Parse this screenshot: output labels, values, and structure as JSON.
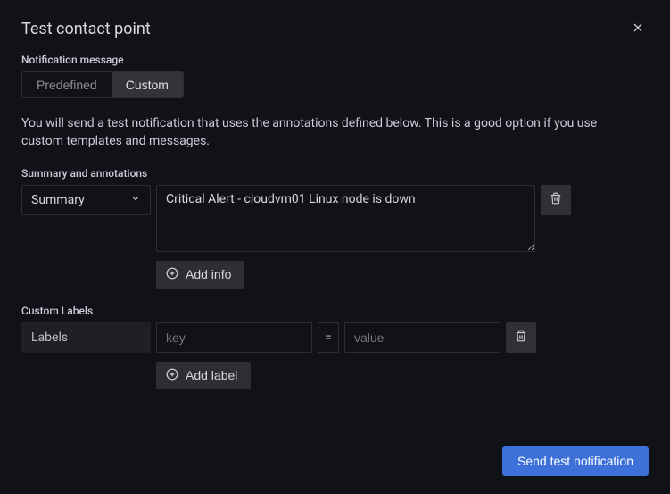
{
  "header": {
    "title": "Test contact point"
  },
  "notification": {
    "label": "Notification message",
    "options": {
      "predefined": "Predefined",
      "custom": "Custom"
    },
    "description": "You will send a test notification that uses the annotations defined below. This is a good option if you use custom templates and messages."
  },
  "annotations": {
    "label": "Summary and annotations",
    "select_value": "Summary",
    "textarea_value": "Critical Alert - cloudvm01 Linux node is down",
    "add_button": "Add info"
  },
  "labels": {
    "label": "Custom Labels",
    "field_name": "Labels",
    "key_placeholder": "key",
    "equals": "=",
    "value_placeholder": "value",
    "key_value": "",
    "value_value": "",
    "add_button": "Add label"
  },
  "footer": {
    "send_button": "Send test notification"
  }
}
